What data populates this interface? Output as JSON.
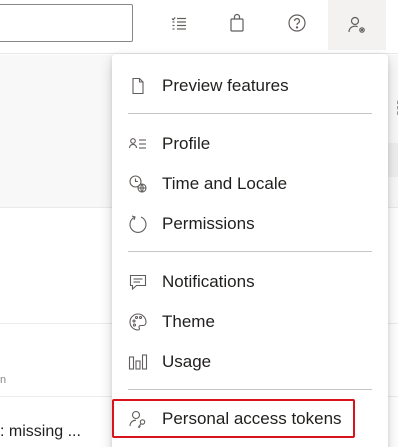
{
  "topbar": {
    "search": {
      "value": "",
      "placeholder": ""
    },
    "icons": [
      "task-list-icon",
      "shopping-bag-icon",
      "help-icon",
      "user-settings-icon"
    ]
  },
  "background": {
    "small_text": "n",
    "row_text": ": missing ..."
  },
  "menu": {
    "preview_features": "Preview features",
    "profile": "Profile",
    "time_and_locale": "Time and Locale",
    "permissions": "Permissions",
    "notifications": "Notifications",
    "theme": "Theme",
    "usage": "Usage",
    "personal_access_tokens": "Personal access tokens"
  },
  "colors": {
    "highlight_border": "#d8131b",
    "separator": "#c8c6c4",
    "icon": "#605e5c"
  }
}
